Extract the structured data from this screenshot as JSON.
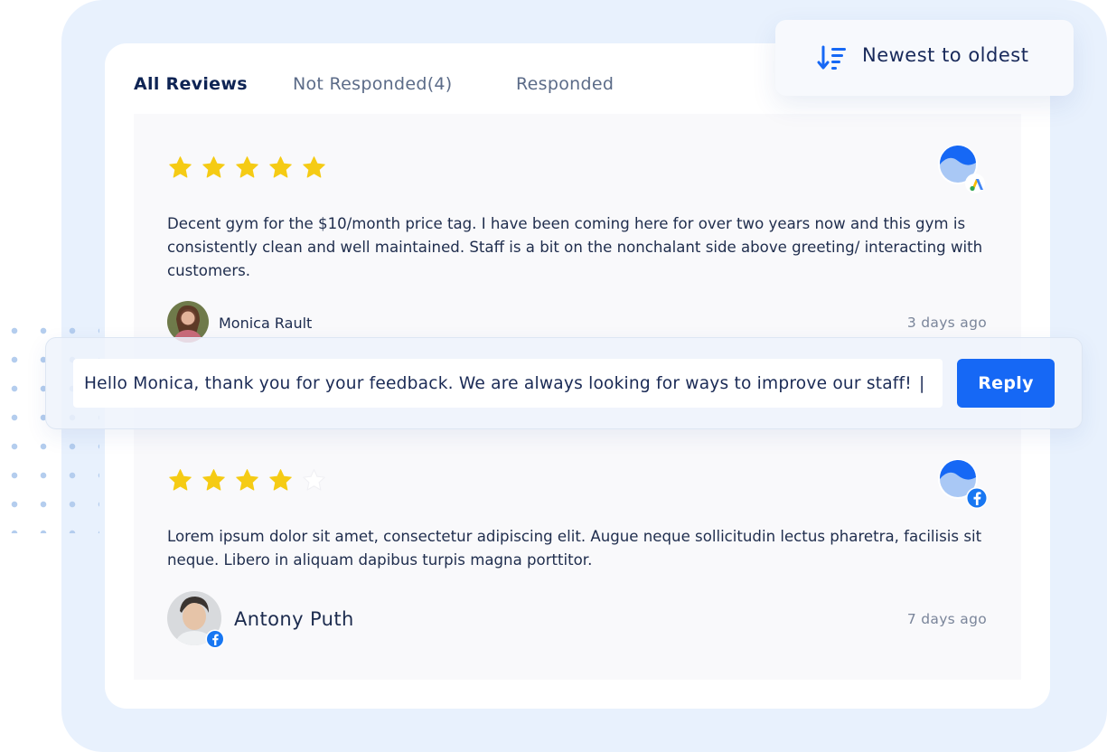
{
  "tabs": [
    {
      "label": "All Reviews",
      "active": true
    },
    {
      "label": "Not Responded(4)",
      "active": false
    },
    {
      "label": "Responded",
      "active": false
    }
  ],
  "sort": {
    "label": "Newest to oldest",
    "icon": "sort-descending-icon"
  },
  "reviews": [
    {
      "rating": 5,
      "max_rating": 5,
      "platform": "google-ads",
      "text": "Decent gym for the $10/month price tag. I have been coming here for over two years now and this gym is consistently clean and well maintained. Staff is a bit on the nonchalant side above greeting/ interacting with customers.",
      "author": "Monica Rault",
      "time": "3 days ago"
    },
    {
      "rating": 4,
      "max_rating": 5,
      "platform": "facebook",
      "text": "Lorem ipsum dolor sit amet, consectetur adipiscing elit. Augue neque sollicitudin lectus pharetra, facilisis sit neque. Libero in aliquam dapibus turpis magna porttitor.",
      "author": "Antony Puth",
      "time": "7 days ago"
    }
  ],
  "reply": {
    "value": "Hello Monica, thank you for your feedback. We are always looking for ways to improve our staff!",
    "caret": "|",
    "button_label": "Reply"
  },
  "colors": {
    "accent": "#1668f5",
    "star": "#f5cb14",
    "star_empty": "#ffffff",
    "background": "#e8f1fd",
    "facebook": "#1877f2"
  }
}
